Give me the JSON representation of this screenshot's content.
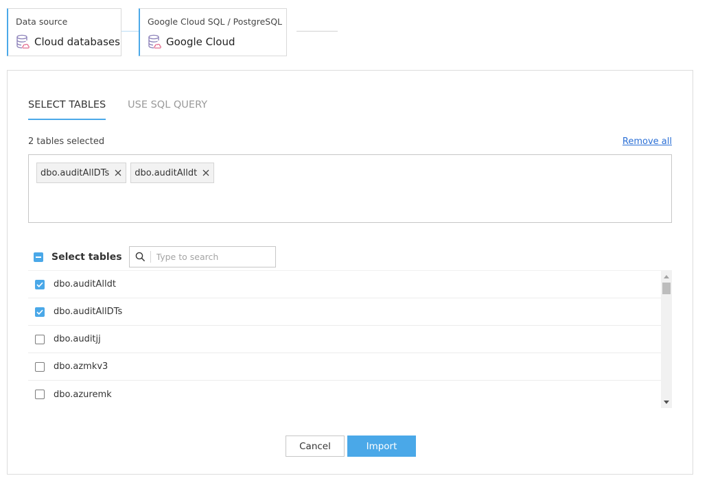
{
  "breadcrumb": {
    "steps": [
      {
        "label": "Data source",
        "value": "Cloud databases"
      },
      {
        "label": "Google Cloud SQL / PostgreSQL",
        "value": "Google Cloud"
      }
    ]
  },
  "tabs": [
    {
      "label": "SELECT TABLES",
      "active": true
    },
    {
      "label": "USE SQL QUERY",
      "active": false
    }
  ],
  "selection": {
    "count_text": "2 tables selected",
    "remove_all_label": "Remove all",
    "chips": [
      "dbo.auditAllDTs",
      "dbo.auditAlldt"
    ]
  },
  "table_picker": {
    "title": "Select tables",
    "search_placeholder": "Type to search",
    "rows": [
      {
        "name": "dbo.auditAlldt",
        "checked": true
      },
      {
        "name": "dbo.auditAllDTs",
        "checked": true
      },
      {
        "name": "dbo.auditjj",
        "checked": false
      },
      {
        "name": "dbo.azmkv3",
        "checked": false
      },
      {
        "name": "dbo.azuremk",
        "checked": false
      }
    ]
  },
  "buttons": {
    "cancel": "Cancel",
    "import": "Import"
  },
  "colors": {
    "accent": "#4aa8e8",
    "link": "#2a6fd6",
    "border": "#c6c6c6"
  },
  "icons": {
    "datasource": "database-cloud-icon",
    "close": "close-icon",
    "search": "search-icon",
    "check": "check-icon"
  }
}
